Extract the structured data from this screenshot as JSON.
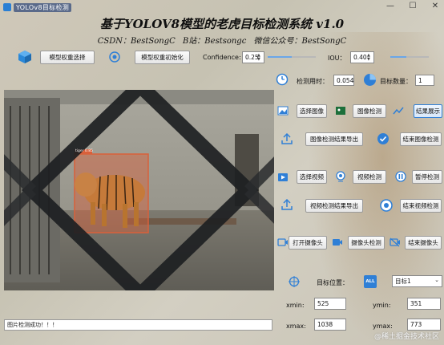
{
  "window": {
    "title": "YOLOv8目标检测",
    "controls": [
      "—",
      "☐",
      "✕"
    ]
  },
  "header": {
    "title": "基于YOLOV8模型的老虎目标检测系统 v1.0",
    "subtitle": "CSDN：BestSongC   B站：Bestsongc   微信公众号：BestSongC"
  },
  "toolbar": {
    "model_select_label": "模型权重选择",
    "model_init_label": "模型权重初始化",
    "confidence_label": "Confidence:",
    "confidence_value": "0.25",
    "confidence_slider": 0.25,
    "iou_label": "IOU：",
    "iou_value": "0.40",
    "iou_slider": 0.4
  },
  "stats": {
    "time_label": "检测用时：",
    "time_value": "0.054",
    "count_label": "目标数量：",
    "count_value": "1"
  },
  "image_actions": {
    "select_image": "选择图像",
    "detect_image": "图像检测",
    "show_result": "结果展示",
    "export_image_result": "图像检测结果导出",
    "end_image_detect": "结束图像检测"
  },
  "video_actions": {
    "select_video": "选择视频",
    "detect_video": "视频检测",
    "pause_detect": "暂停检测",
    "export_video_result": "视频检测结果导出",
    "end_video_detect": "结束视频检测"
  },
  "camera_actions": {
    "open_camera": "打开摄像头",
    "camera_detect": "摄像头检测",
    "end_camera_detect": "结束摄像头"
  },
  "target": {
    "position_label": "目标位置：",
    "all_label": "ALL",
    "selected": "目标1",
    "xmin_label": "xmin:",
    "xmin_value": "525",
    "ymin_label": "ymin:",
    "ymin_value": "351",
    "xmax_label": "xmax:",
    "xmax_value": "1038",
    "ymax_label": "ymax:",
    "ymax_value": "773"
  },
  "detection": {
    "label": "tiger 0.85"
  },
  "status": {
    "message": "图片检测成功！！！"
  },
  "watermark": "@稀土掘金技术社区",
  "colors": {
    "accent": "#2f7fd6",
    "box": "#d9603a"
  }
}
